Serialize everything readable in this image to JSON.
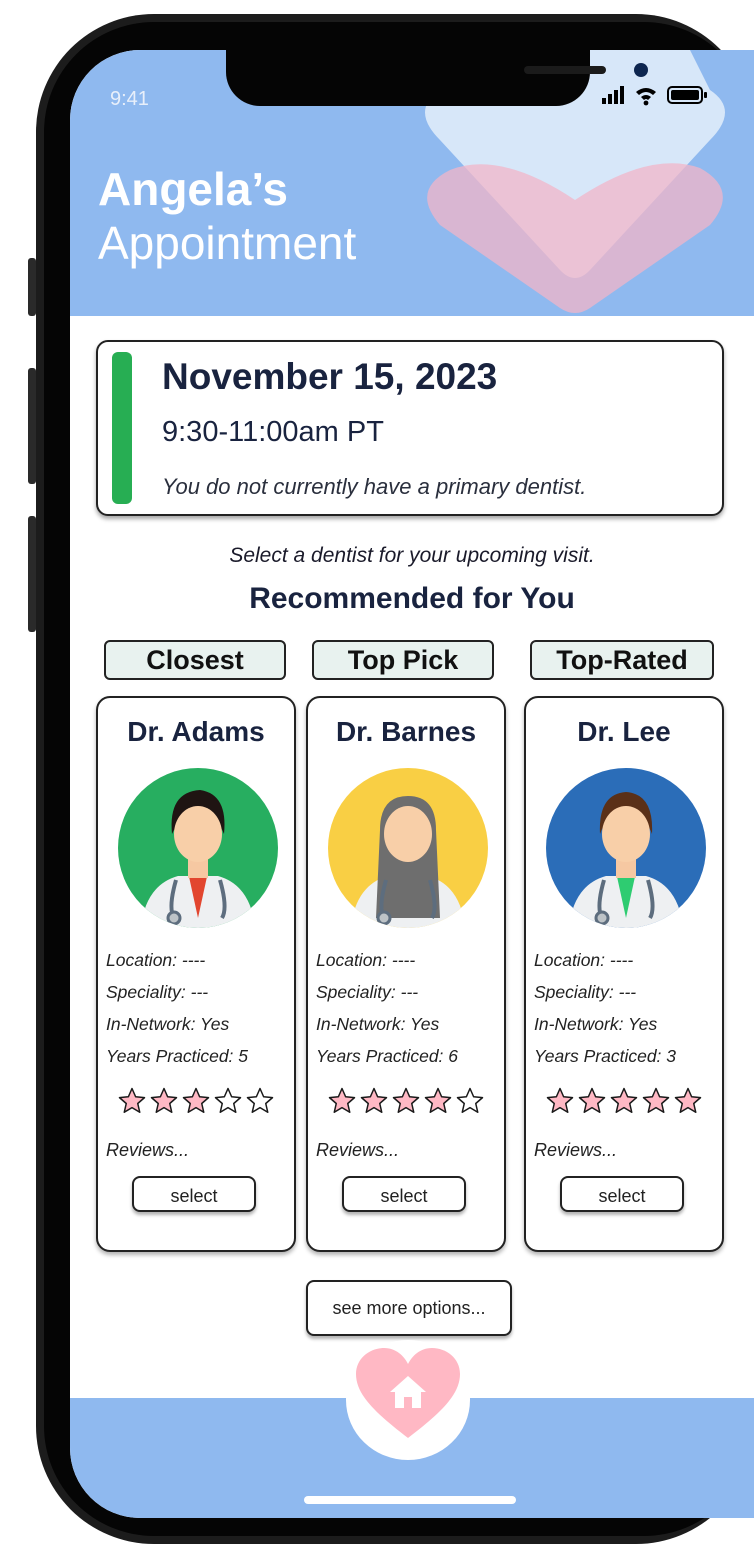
{
  "status_bar": {
    "time": "9:41"
  },
  "header": {
    "title_line1": "Angela’s",
    "title_line2": "Appointment"
  },
  "appointment": {
    "date": "November 15, 2023",
    "time": "9:30-11:00am PT",
    "note": "You do not currently have a primary dentist."
  },
  "prompt": "Select a dentist for your upcoming visit.",
  "section_title": "Recommended for You",
  "tags": [
    "Closest",
    "Top Pick",
    "Top-Rated"
  ],
  "dentists": [
    {
      "name": "Dr. Adams",
      "location": "Location: ----",
      "speciality": "Speciality: ---",
      "network": "In-Network: Yes",
      "years": "Years Practiced: 5",
      "rating": 3,
      "max_rating": 5,
      "reviews": "Reviews...",
      "select_label": "select",
      "avatar_bg": "#27ae60",
      "tie_color": "#e2462f",
      "hair": "dark-short"
    },
    {
      "name": "Dr. Barnes",
      "location": "Location: ----",
      "speciality": "Speciality: ---",
      "network": "In-Network: Yes",
      "years": "Years Practiced: 6",
      "rating": 4,
      "max_rating": 5,
      "reviews": "Reviews...",
      "select_label": "select",
      "avatar_bg": "#f9cf44",
      "tie_color": "#36b8b0",
      "hair": "long-grey"
    },
    {
      "name": "Dr. Lee",
      "location": "Location: ----",
      "speciality": "Speciality: ---",
      "network": "In-Network: Yes",
      "years": "Years Practiced: 3",
      "rating": 5,
      "max_rating": 5,
      "reviews": "Reviews...",
      "select_label": "select",
      "avatar_bg": "#2b6db8",
      "tie_color": "#2ecc71",
      "hair": "brown-short"
    }
  ],
  "more_options": "see more options...",
  "colors": {
    "header": "#8fb9ef",
    "accent_green": "#27ae53",
    "heart_pink": "#ffb8c4",
    "tag_bg": "#e8f2ef"
  },
  "icons": {
    "home": "home-icon",
    "signal": "signal-icon",
    "wifi": "wifi-icon",
    "battery": "battery-icon"
  }
}
